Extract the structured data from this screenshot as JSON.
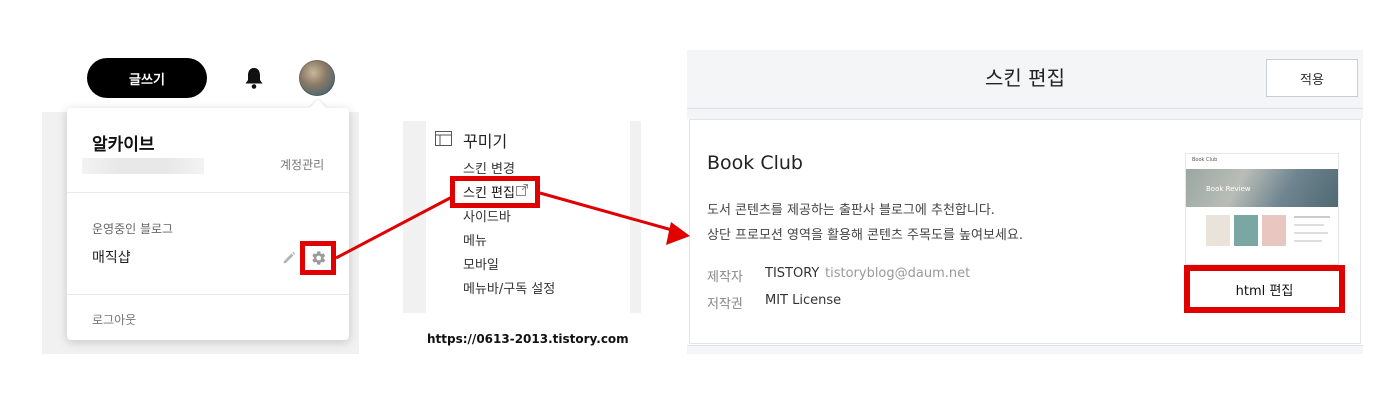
{
  "topbar": {
    "write_label": "글쓰기"
  },
  "dropdown": {
    "blog_title": "알카이브",
    "account_manage": "계정관리",
    "running_blogs_label": "운영중인 블로그",
    "blog_name": "매직샵",
    "logout": "로그아웃"
  },
  "settings_menu": {
    "section_title": "꾸미기",
    "items": [
      "스킨 변경",
      "스킨 편집",
      "사이드바",
      "메뉴",
      "모바일",
      "메뉴바/구독 설정"
    ],
    "highlighted_item": "스킨 편집"
  },
  "url_caption": "https://0613-2013.tistory.com",
  "skin_editor": {
    "title": "스킨 편집",
    "apply_label": "적용",
    "skin_name": "Book Club",
    "description_line1": "도서 콘텐츠를 제공하는 출판사 블로그에 추천합니다.",
    "description_line2": "상단 프로모션 영역을 활용해 콘텐츠 주목도를 높여보세요.",
    "maker_label": "제작자",
    "maker_name": "TISTORY",
    "maker_email": "tistoryblog@daum.net",
    "license_label": "저작권",
    "license_value": "MIT License",
    "html_edit_label": "html 편집",
    "thumbnail_brand": "Book Club",
    "thumbnail_banner": "Book Review"
  },
  "colors": {
    "highlight_red": "#e00000",
    "write_button": "#000000",
    "panel_gray": "#f1f1f1"
  },
  "icons": [
    "bell-icon",
    "avatar",
    "pencil-icon",
    "gear-icon",
    "layout-icon",
    "external-link-icon",
    "arrow-icon"
  ]
}
